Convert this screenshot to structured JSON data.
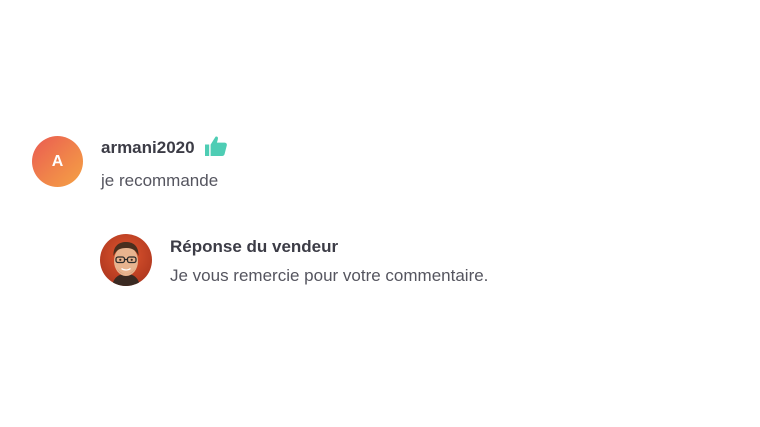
{
  "review": {
    "avatar_initial": "A",
    "username": "armani2020",
    "comment": "je recommande",
    "thumb_color": "#4ecdb4"
  },
  "seller_reply": {
    "title": "Réponse du vendeur",
    "text": "Je vous remercie pour votre commentaire."
  },
  "colors": {
    "avatar_gradient_start": "#ea5a52",
    "avatar_gradient_end": "#f5a245",
    "text_primary": "#3c3c46",
    "text_secondary": "#55555f"
  }
}
